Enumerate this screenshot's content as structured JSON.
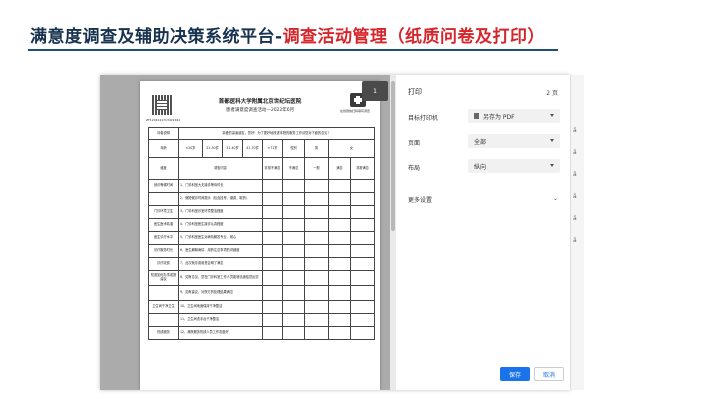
{
  "slide": {
    "title_main": "满意度调查及辅助决策系统平台-",
    "title_accent": "调查活动管理（纸质问卷及打印）"
  },
  "preview": {
    "page_number": "1",
    "hospital": "首都医科大学附属北京世纪坛医院",
    "survey_title": "患者满意度调查活动—2022年6月",
    "qr_caption": "ZF1202241713422461",
    "icon_caption": "在线微信扫码填写调查",
    "table": {
      "r1": [
        "问卷说明",
        "亲爱的患者朋友，您好！为了更好地改进本院的服务工作请您对下面的意见！"
      ],
      "age_label": "年龄",
      "ages": [
        "<20岁",
        "21-30岁",
        "31-40岁",
        "41-70岁",
        ">71岁"
      ],
      "gender_label": "性别",
      "genders": [
        "男",
        "女"
      ],
      "head": [
        "维度",
        "调查内容",
        "非常不满意",
        "不满意",
        "一般",
        "满意",
        "非常满意"
      ],
      "rows": [
        [
          "就诊等候时间",
          "1、门诊科室大夫接诊等待时长"
        ],
        [
          "",
          "2、缩短候诊时间提示（包含挂号、缴费、取药）"
        ],
        [
          "门诊环境卫生",
          "3、门诊科室诊室环境整洁程度"
        ],
        [
          "医生医术精湛",
          "4、门诊科室医生接诊认真程度"
        ],
        [
          "医生诊疗水平",
          "5、门诊科室医生对病情解答专业、耐心"
        ],
        [
          "诊疗服务时长",
          "6、医生解释病情、用药注意事项的详细度"
        ],
        [
          "诊疗收费",
          "7、此次就诊费用是否明了满意"
        ],
        [
          "知道如何办事或提建议",
          "8、如有意见，您在门诊科室工作人员能够迅速给您反馈"
        ],
        [
          "",
          "9、如有建议，对院方的处理结果满意"
        ],
        [
          "卫生间干净卫生",
          "10、卫生间地面保持干净整洁"
        ],
        [
          "",
          "11、卫生间洗手台干净整洁"
        ],
        [
          "热线服务",
          "12、我院服务热线人员工作态度好"
        ]
      ]
    }
  },
  "settings": {
    "title": "打印",
    "pages": "2 页",
    "printer_label": "目标打印机",
    "printer_value": "另存为 PDF",
    "pages_label": "页面",
    "pages_value": "全部",
    "layout_label": "布局",
    "layout_value": "纵向",
    "more_label": "更多设置",
    "save_label": "保存",
    "cancel_label": "取消"
  },
  "background": {
    "edge_chars": [
      "ä",
      "ä",
      "ä",
      "ä",
      "ä",
      "ä"
    ]
  }
}
